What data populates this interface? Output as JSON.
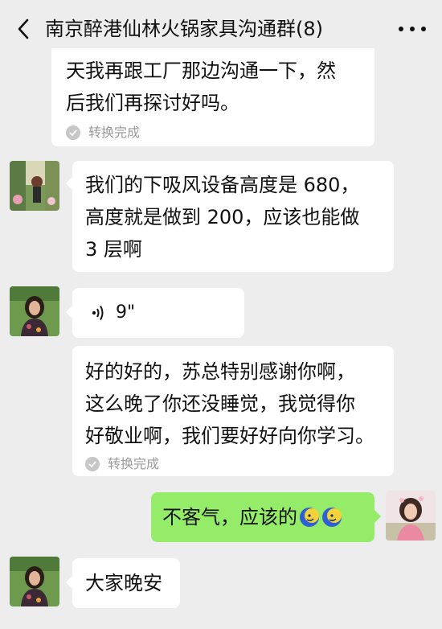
{
  "header": {
    "title": "南京醉港仙林火锅家具沟通群(8)",
    "back_icon": "chevron-left-icon",
    "more_icon": "more-dots-icon"
  },
  "messages": [
    {
      "sender": "other",
      "lines": [
        "天我再跟工厂那边沟通一下，然",
        "后我们再探讨好吗。"
      ],
      "status": "转换完成"
    },
    {
      "sender": "other",
      "lines": [
        "我们的下吸风设备高度是 680，",
        "高度就是做到 200，应该也能做",
        "3 层啊"
      ]
    },
    {
      "sender": "other",
      "type": "voice",
      "duration": "9\""
    },
    {
      "sender": "other",
      "lines": [
        "好的好的，苏总特别感谢你啊，",
        "这么晚了你还没睡觉，我觉得你",
        "好敬业啊，我们要好好向你学习。"
      ],
      "status": "转换完成"
    },
    {
      "sender": "me",
      "text": "不客气，应该的"
    },
    {
      "sender": "other",
      "text": "大家晚安"
    }
  ],
  "colors": {
    "background": "#ededed",
    "bubble_other": "#ffffff",
    "bubble_self": "#95ec69",
    "status_text": "#9a9a9a"
  }
}
